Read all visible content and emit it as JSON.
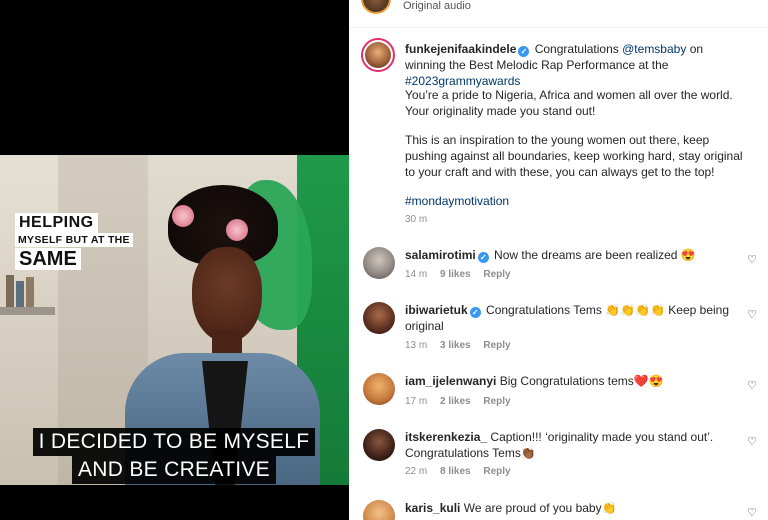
{
  "video": {
    "lower_third": {
      "line1": "HELPING",
      "line2": "MYSELF BUT AT THE",
      "line3": "SAME"
    },
    "caption": {
      "line1": "I DECIDED TO BE MYSELF",
      "line2": "AND BE CREATIVE"
    }
  },
  "audio": {
    "label": "Original audio"
  },
  "post": {
    "username": "funkejenifaakindele",
    "verified": true,
    "caption_part1": "Congratulations",
    "mention": "@temsbaby",
    "caption_part2": "on winning the Best Melodic Rap Performance at the",
    "hashtag": "#2023grammyawards",
    "paragraph2": "You’re a pride to Nigeria, Africa and women all over the world. Your originality made you stand out!",
    "paragraph3": "This is an inspiration to the young women out there, keep pushing against all boundaries, keep working hard, stay original to your craft and with these, you can always get to the top!",
    "tag": "#mondaymotivation",
    "time": "30 m"
  },
  "comments": [
    {
      "username": "salamirotimi",
      "verified": true,
      "text": "Now the dreams are been realized 😍",
      "time": "14 m",
      "likes": "9 likes",
      "reply": "Reply"
    },
    {
      "username": "ibiwarietuk",
      "verified": true,
      "text": "Congratulations Tems 👏👏👏👏 Keep being original",
      "time": "13 m",
      "likes": "3 likes",
      "reply": "Reply"
    },
    {
      "username": "iam_ijelenwanyi",
      "verified": false,
      "text": "Big Congratulations tems❤️😍",
      "time": "17 m",
      "likes": "2 likes",
      "reply": "Reply"
    },
    {
      "username": "itskerenkezia_",
      "verified": false,
      "text": "Caption!!! ‘originality made you stand out’. Congratulations Tems👏🏾",
      "time": "22 m",
      "likes": "8 likes",
      "reply": "Reply"
    },
    {
      "username": "karis_kuli",
      "verified": false,
      "text": "We are proud of you baby👏",
      "time": "",
      "likes": "",
      "reply": ""
    }
  ],
  "icons": {
    "like": "heart-outline-icon",
    "verified": "verified-badge-icon"
  },
  "colors": {
    "verified_blue": "#3897f0",
    "link_blue": "#00376b",
    "meta_gray": "#8e8e8e"
  }
}
